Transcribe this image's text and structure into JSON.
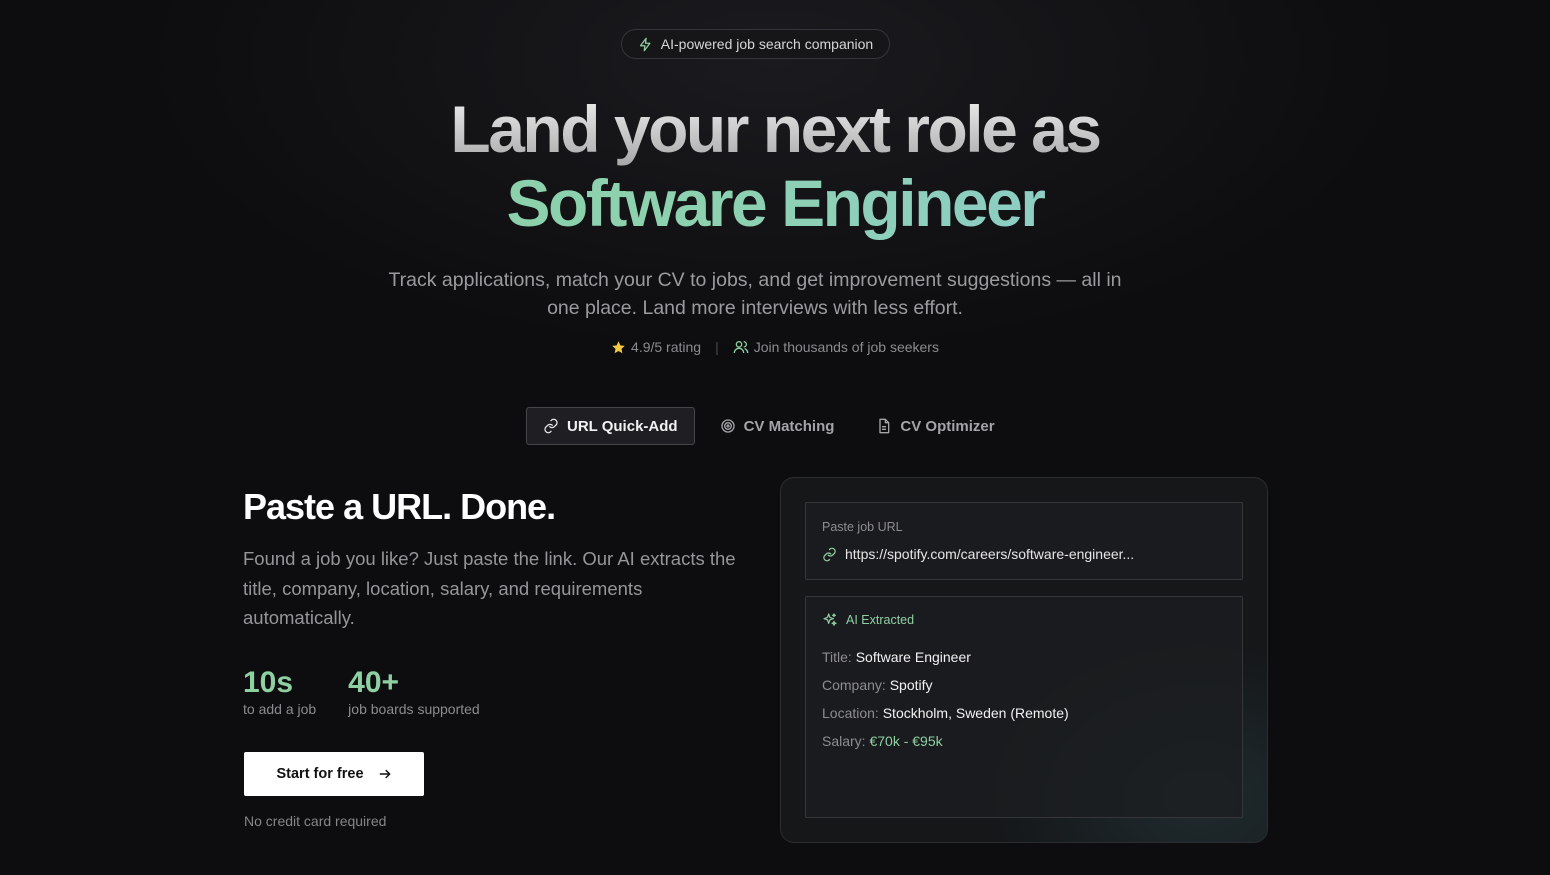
{
  "badge": {
    "text": "AI-powered job search companion",
    "icon": "lightning-icon"
  },
  "hero": {
    "line1": "Land your next role as",
    "line2": "Software Engineer"
  },
  "subtitle": "Track applications, match your CV to jobs, and get improvement suggestions — all in one place. Land more interviews with less effort.",
  "meta": {
    "rating": "4.9/5 rating",
    "separator": "|",
    "join": "Join thousands of job seekers"
  },
  "tabs": [
    {
      "label": "URL Quick-Add",
      "icon": "link-icon",
      "active": true
    },
    {
      "label": "CV Matching",
      "icon": "target-icon",
      "active": false
    },
    {
      "label": "CV Optimizer",
      "icon": "document-icon",
      "active": false
    }
  ],
  "feature": {
    "title": "Paste a URL. Done.",
    "description": "Found a job you like? Just paste the link. Our AI extracts the title, company, location, salary, and requirements automatically.",
    "stats": [
      {
        "value": "10s",
        "label": "to add a job"
      },
      {
        "value": "40+",
        "label": "job boards supported"
      }
    ],
    "cta": "Start for free",
    "note": "No credit card required"
  },
  "card": {
    "input_label": "Paste job URL",
    "input_value": "https://spotify.com/careers/software-engineer...",
    "extracted_label": "AI Extracted",
    "fields": [
      {
        "key": "Title:",
        "value": "Software Engineer"
      },
      {
        "key": "Company:",
        "value": "Spotify"
      },
      {
        "key": "Location:",
        "value": "Stockholm, Sweden (Remote)"
      },
      {
        "key": "Salary:",
        "value": "€70k - €95k"
      }
    ]
  },
  "colors": {
    "accent_green": "#8fd0a2",
    "gradient_blue": "#8fc8e0",
    "background": "#0d0d0f"
  }
}
